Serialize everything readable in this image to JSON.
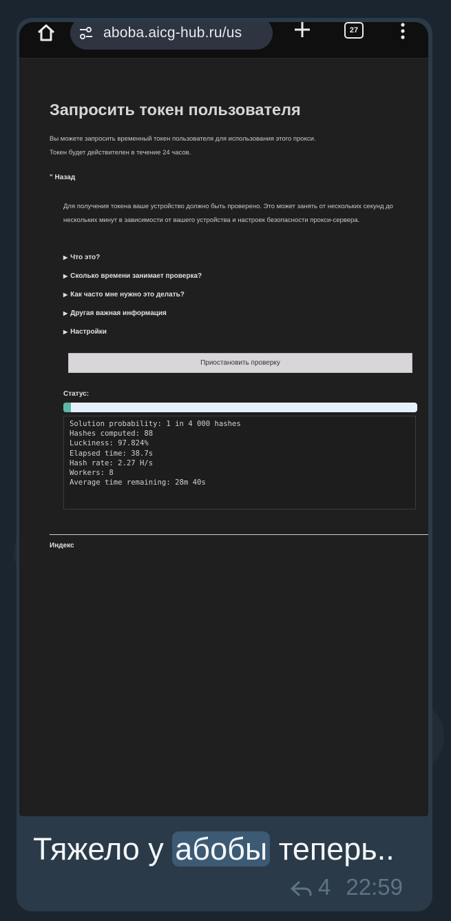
{
  "browser": {
    "url": "aboba.aicg-hub.ru/us",
    "tab_count": "27"
  },
  "page": {
    "title": "Запросить токен пользователя",
    "intro_line1": "Вы можете запросить временный токен пользователя для использования этого прокси.",
    "intro_line2": "Токен будет действителен в течение 24 часов.",
    "back_label": "\" Назад",
    "explanation": "Для получения токена ваше устройство должно быть проверено. Это может занять от нескольких секунд до нескольких минут в зависимости от вашего устройства и настроек безопасности прокси-сервера.",
    "details": [
      "Что это?",
      "Сколько времени занимает проверка?",
      "Как часто мне нужно это делать?",
      "Другая важная информация",
      "Настройки"
    ],
    "pause_button": "Приостановить проверку",
    "status_label": "Статус:",
    "progress_fraction": 0.022,
    "log_lines": [
      "Solution probability: 1 in 4 000 hashes",
      "Hashes computed: 88",
      "Luckiness: 97.824%",
      "Elapsed time: 38.7s",
      "Hash rate: 2.27 H/s",
      "Workers: 8",
      "Average time remaining: 28m 40s"
    ],
    "index_link": "Индекс"
  },
  "message": {
    "text_before": "Тяжело у ",
    "highlight": "абобы",
    "text_after": " теперь..",
    "reply_count": "4",
    "time": "22:59"
  },
  "colors": {
    "bubble": "#2b3a48",
    "progress_fill": "#5fb6a8",
    "progress_track": "#e6f0fb"
  }
}
